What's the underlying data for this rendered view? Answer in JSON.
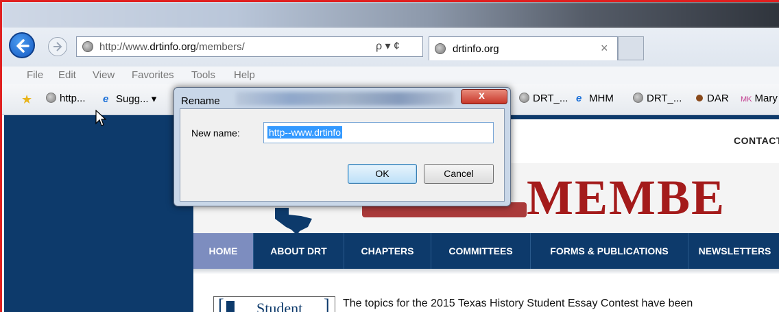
{
  "browser": {
    "address_url_prefix": "http://www.",
    "address_url_domain": "drtinfo.org",
    "address_url_suffix": "/members/",
    "address_controls": "ρ ▾ ¢",
    "tab_title": "drtinfo.org",
    "tab_close": "×",
    "menu": [
      "File",
      "Edit",
      "View",
      "Favorites",
      "Tools",
      "Help"
    ],
    "favorites": {
      "item1": "http...",
      "item2": "Sugg...",
      "item3": "DRT_...",
      "item4": "MHM",
      "item5": "DRT_...",
      "item6": "DAR",
      "item7_prefix": "MK",
      "item7": "Mary"
    }
  },
  "site": {
    "contact": "CONTACT",
    "logo_text": "MEMBE",
    "nav": [
      "HOME",
      "ABOUT DRT",
      "CHAPTERS",
      "COMMITTEES",
      "FORMS & PUBLICATIONS",
      "NEWSLETTERS"
    ],
    "thumb_text": "Student",
    "body_text": "The topics for the 2015 Texas History Student Essay Contest have been"
  },
  "dialog": {
    "title": "Rename",
    "close": "x",
    "label": "New name:",
    "value": "http--www.drtinfo",
    "ok": "OK",
    "cancel": "Cancel"
  },
  "colors": {
    "frame": "#e02020",
    "site_navy": "#0d3a6b",
    "logo_red": "#a41b1b",
    "nav_active": "#7d8dbf"
  }
}
